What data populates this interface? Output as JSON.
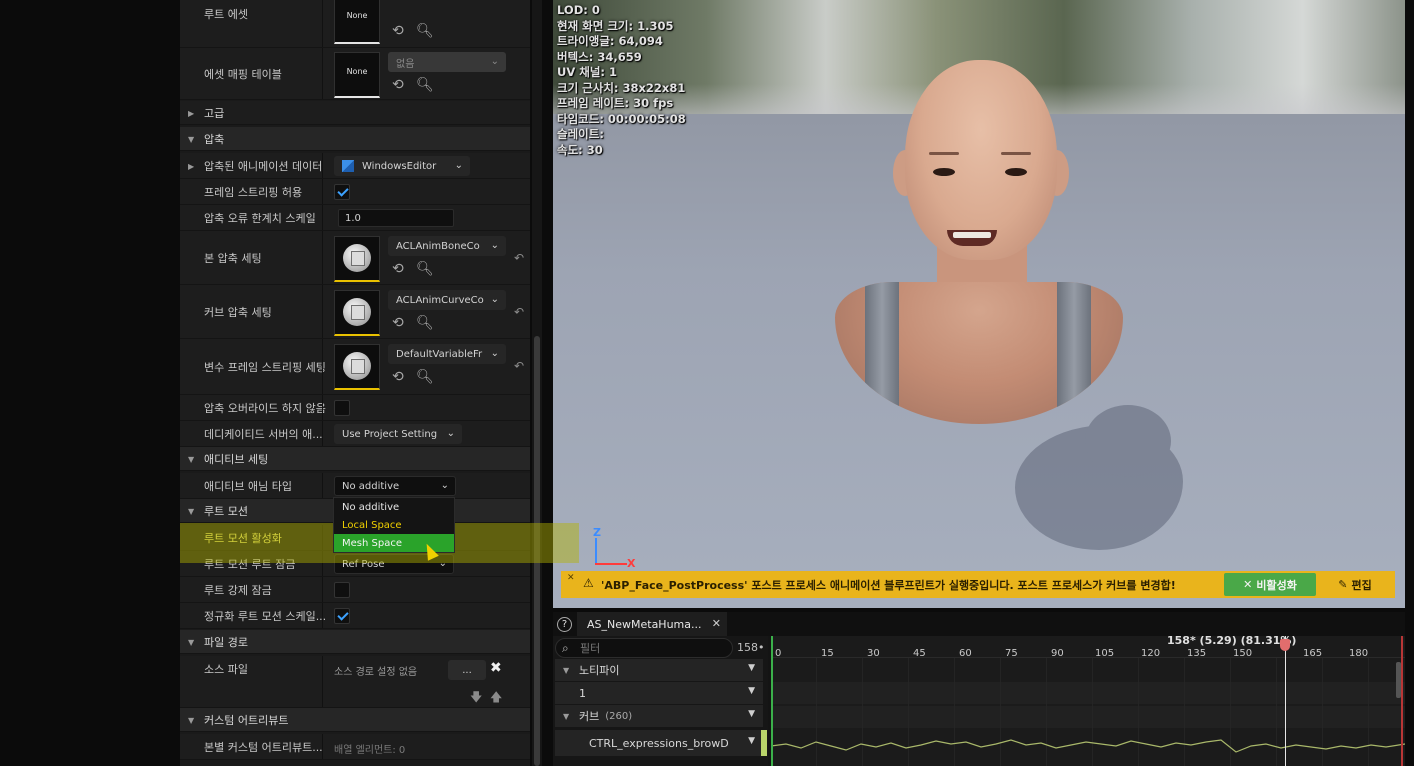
{
  "details": {
    "rows": {
      "retarget_asset_label": "루트 에셋",
      "asset_mapping_label": "에셋 매핑 테이블",
      "none_thumb": "None",
      "none_combo": "없음",
      "advanced_label": "고급",
      "compression_label": "압축",
      "compressed_data_label": "압축된 애니메이션 데이터",
      "platform_value": "WindowsEditor",
      "allow_frame_strip_label": "프레임 스트리핑 허용",
      "error_scale_label": "압축 오류 한계치 스케일",
      "error_scale_value": "1.0",
      "bone_compression_label": "본 압축 세팅",
      "bone_compression_value": "ACLAnimBoneCo",
      "curve_compression_label": "커브 압축 세팅",
      "curve_compression_value": "ACLAnimCurveCo",
      "var_frame_label": "변수 프레임 스트리핑 세팅",
      "var_frame_value": "DefaultVariableFr",
      "no_override_label": "압축 오버라이드 하지 않음",
      "dedicated_label": "데디케이티드 서버의 애...",
      "dedicated_value": "Use Project Setting",
      "additive_label": "애디티브 세팅",
      "additive_type_label": "애디티브 애님 타입",
      "additive_type_value": "No additive",
      "root_motion_label": "루트 모션",
      "enable_root_motion_label": "루트 모션 활성화",
      "root_lock_label": "루트 모션 루트 잠금",
      "root_lock_value": "Ref Pose",
      "force_root_lock_label": "루트 강제 잠금",
      "normalize_root_label": "정규화 루트 모션 스케일...",
      "import_path_label": "파일 경로",
      "source_file_label": "소스 파일",
      "source_file_value": "소스 경로 설정 없음",
      "browse_label": "...",
      "custom_attr_label": "커스텀 어트리뷰트",
      "bone_custom_attr_label": "본별 커스텀 어트리뷰트...",
      "bone_custom_attr_value": "배열 엘리먼트: 0"
    },
    "dropdown_options": [
      "No additive",
      "Local Space",
      "Mesh Space"
    ]
  },
  "viewport": {
    "stats": [
      "LOD: 0",
      "현재 화면 크기: 1.305",
      "트라이앵글: 64,094",
      "버텍스: 34,659",
      "UV 채널: 1",
      "크기 근사치: 38x22x81",
      "프레임 레이트: 30 fps",
      "타임코드: 00:00:05:08",
      "슬레이트:",
      "속도: 30"
    ],
    "axis_z": "Z",
    "axis_x": "X",
    "warning_message": "'ABP_Face_PostProcess' 포스트 프로세스 애니메이션 블루프린트가 실행중입니다. 포스트 프로세스가 커브를 변경합!",
    "disable_button": "비활성화",
    "edit_button": "편집"
  },
  "sequencer": {
    "tab_label": "AS_NewMetaHuma...",
    "filter_placeholder": "필터",
    "frame_count": "158",
    "current_frame_label": "158* (5.29) (81.31%)",
    "ticks": [
      "0",
      "15",
      "30",
      "45",
      "60",
      "75",
      "90",
      "105",
      "120",
      "135",
      "150",
      "165",
      "180"
    ],
    "tracks": {
      "notify_label": "노티파이",
      "notify_index": "1",
      "curves_label": "커브",
      "curves_count": "(260)",
      "curve_item": "CTRL_expressions_browD"
    }
  },
  "colors": {
    "accent_green": "#2aa32a",
    "warning_yellow": "#e9b41c",
    "highlight_yellow": "#f0d000",
    "check_blue": "#3da2ff"
  }
}
